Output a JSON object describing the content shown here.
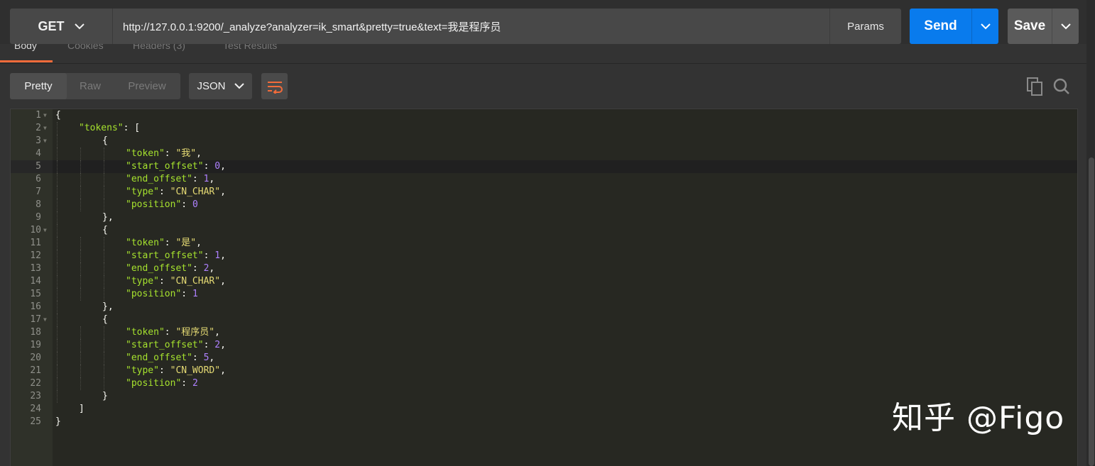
{
  "request": {
    "method": "GET",
    "url": "http://127.0.0.1:9200/_analyze?analyzer=ik_smart&pretty=true&text=我是程序员",
    "params_label": "Params",
    "send_label": "Send",
    "save_label": "Save"
  },
  "response_tabs": [
    "Body",
    "Cookies",
    "Headers (3)",
    "Test Results"
  ],
  "format": {
    "modes": [
      "Pretty",
      "Raw",
      "Preview"
    ],
    "active_mode": "Pretty",
    "language": "JSON"
  },
  "editor": {
    "active_line": 5,
    "lines": [
      {
        "n": "1",
        "fold": true,
        "indent": 0,
        "tokens": [
          [
            "p",
            "{"
          ]
        ]
      },
      {
        "n": "2",
        "fold": true,
        "indent": 1,
        "tokens": [
          [
            "k",
            "\"tokens\""
          ],
          [
            "p",
            ": ["
          ]
        ]
      },
      {
        "n": "3",
        "fold": true,
        "indent": 2,
        "tokens": [
          [
            "p",
            "{"
          ]
        ]
      },
      {
        "n": "4",
        "fold": false,
        "indent": 3,
        "tokens": [
          [
            "k",
            "\"token\""
          ],
          [
            "p",
            ": "
          ],
          [
            "s",
            "\"我\""
          ],
          [
            "p",
            ","
          ]
        ]
      },
      {
        "n": "5",
        "fold": false,
        "indent": 3,
        "tokens": [
          [
            "k",
            "\"start_offset\""
          ],
          [
            "p",
            ": "
          ],
          [
            "n",
            "0"
          ],
          [
            "p",
            ","
          ]
        ]
      },
      {
        "n": "6",
        "fold": false,
        "indent": 3,
        "tokens": [
          [
            "k",
            "\"end_offset\""
          ],
          [
            "p",
            ": "
          ],
          [
            "n",
            "1"
          ],
          [
            "p",
            ","
          ]
        ]
      },
      {
        "n": "7",
        "fold": false,
        "indent": 3,
        "tokens": [
          [
            "k",
            "\"type\""
          ],
          [
            "p",
            ": "
          ],
          [
            "s",
            "\"CN_CHAR\""
          ],
          [
            "p",
            ","
          ]
        ]
      },
      {
        "n": "8",
        "fold": false,
        "indent": 3,
        "tokens": [
          [
            "k",
            "\"position\""
          ],
          [
            "p",
            ": "
          ],
          [
            "n",
            "0"
          ]
        ]
      },
      {
        "n": "9",
        "fold": false,
        "indent": 2,
        "tokens": [
          [
            "p",
            "},"
          ]
        ]
      },
      {
        "n": "10",
        "fold": true,
        "indent": 2,
        "tokens": [
          [
            "p",
            "{"
          ]
        ]
      },
      {
        "n": "11",
        "fold": false,
        "indent": 3,
        "tokens": [
          [
            "k",
            "\"token\""
          ],
          [
            "p",
            ": "
          ],
          [
            "s",
            "\"是\""
          ],
          [
            "p",
            ","
          ]
        ]
      },
      {
        "n": "12",
        "fold": false,
        "indent": 3,
        "tokens": [
          [
            "k",
            "\"start_offset\""
          ],
          [
            "p",
            ": "
          ],
          [
            "n",
            "1"
          ],
          [
            "p",
            ","
          ]
        ]
      },
      {
        "n": "13",
        "fold": false,
        "indent": 3,
        "tokens": [
          [
            "k",
            "\"end_offset\""
          ],
          [
            "p",
            ": "
          ],
          [
            "n",
            "2"
          ],
          [
            "p",
            ","
          ]
        ]
      },
      {
        "n": "14",
        "fold": false,
        "indent": 3,
        "tokens": [
          [
            "k",
            "\"type\""
          ],
          [
            "p",
            ": "
          ],
          [
            "s",
            "\"CN_CHAR\""
          ],
          [
            "p",
            ","
          ]
        ]
      },
      {
        "n": "15",
        "fold": false,
        "indent": 3,
        "tokens": [
          [
            "k",
            "\"position\""
          ],
          [
            "p",
            ": "
          ],
          [
            "n",
            "1"
          ]
        ]
      },
      {
        "n": "16",
        "fold": false,
        "indent": 2,
        "tokens": [
          [
            "p",
            "},"
          ]
        ]
      },
      {
        "n": "17",
        "fold": true,
        "indent": 2,
        "tokens": [
          [
            "p",
            "{"
          ]
        ]
      },
      {
        "n": "18",
        "fold": false,
        "indent": 3,
        "tokens": [
          [
            "k",
            "\"token\""
          ],
          [
            "p",
            ": "
          ],
          [
            "s",
            "\"程序员\""
          ],
          [
            "p",
            ","
          ]
        ]
      },
      {
        "n": "19",
        "fold": false,
        "indent": 3,
        "tokens": [
          [
            "k",
            "\"start_offset\""
          ],
          [
            "p",
            ": "
          ],
          [
            "n",
            "2"
          ],
          [
            "p",
            ","
          ]
        ]
      },
      {
        "n": "20",
        "fold": false,
        "indent": 3,
        "tokens": [
          [
            "k",
            "\"end_offset\""
          ],
          [
            "p",
            ": "
          ],
          [
            "n",
            "5"
          ],
          [
            "p",
            ","
          ]
        ]
      },
      {
        "n": "21",
        "fold": false,
        "indent": 3,
        "tokens": [
          [
            "k",
            "\"type\""
          ],
          [
            "p",
            ": "
          ],
          [
            "s",
            "\"CN_WORD\""
          ],
          [
            "p",
            ","
          ]
        ]
      },
      {
        "n": "22",
        "fold": false,
        "indent": 3,
        "tokens": [
          [
            "k",
            "\"position\""
          ],
          [
            "p",
            ": "
          ],
          [
            "n",
            "2"
          ]
        ]
      },
      {
        "n": "23",
        "fold": false,
        "indent": 2,
        "tokens": [
          [
            "p",
            "}"
          ]
        ]
      },
      {
        "n": "24",
        "fold": false,
        "indent": 1,
        "tokens": [
          [
            "p",
            "]"
          ]
        ]
      },
      {
        "n": "25",
        "fold": false,
        "indent": 0,
        "tokens": [
          [
            "p",
            "}"
          ]
        ]
      }
    ]
  },
  "watermark": "知乎 @Figo",
  "colors": {
    "send": "#097bed",
    "tab_accent": "#f26b3a",
    "json_key": "#a6e22e",
    "json_string": "#e6db74",
    "json_number": "#ae81ff"
  }
}
